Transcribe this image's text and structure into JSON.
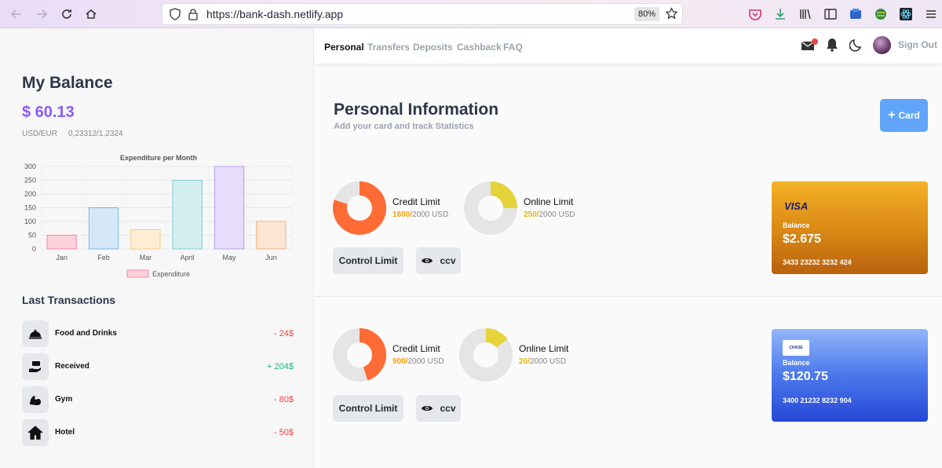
{
  "browser": {
    "url": "https://bank-dash.netlify.app",
    "zoom": "80%"
  },
  "sidebar": {
    "balance_title": "My Balance",
    "balance_amount": "$ 60.13",
    "rate_label": "USD/EUR",
    "rate_value": "0,23312/1,2324",
    "transactions_title": "Last Transactions",
    "transactions": [
      {
        "name": "Food and Drinks",
        "amount": "- 24$",
        "type": "negative",
        "icon": "food-cloche-icon"
      },
      {
        "name": "Received",
        "amount": "+ 204$",
        "type": "positive",
        "icon": "money-hand-icon"
      },
      {
        "name": "Gym",
        "amount": "- 80$",
        "type": "negative",
        "icon": "muscle-arm-icon"
      },
      {
        "name": "Hotel",
        "amount": "- 50$",
        "type": "negative",
        "icon": "house-icon"
      }
    ]
  },
  "chart_data": {
    "type": "bar",
    "title": "Expenditure per Month",
    "categories": [
      "Jan",
      "Feb",
      "Mar",
      "April",
      "May",
      "Jun"
    ],
    "series": [
      {
        "name": "Expenditure",
        "values": [
          50,
          150,
          70,
          250,
          300,
          100
        ]
      }
    ],
    "bar_colors": [
      "#fbd1dc",
      "#d4e8f8",
      "#fdedd3",
      "#d3efef",
      "#e6dcfb",
      "#fde6d3"
    ],
    "bar_borders": [
      "#f58aa5",
      "#7fb6e8",
      "#f6cc86",
      "#7fcfcf",
      "#b69cf1",
      "#f5b07f"
    ],
    "ylim": [
      0,
      300
    ],
    "yticks": [
      "300",
      "250",
      "200",
      "150",
      "100",
      "50",
      "0"
    ],
    "legend": "bottom",
    "grid": true
  },
  "topnav": {
    "tabs": [
      "Personal",
      "Transfers",
      "Deposits",
      "Cashback",
      "FAQ"
    ],
    "signout": "Sign Out"
  },
  "main": {
    "title": "Personal Information",
    "subtitle": "Add your card and track Statistics",
    "add_card_label": "Card",
    "control_limit_label": "Control Limit",
    "ccv_label": "ccv",
    "cards": [
      {
        "credit_title": "Credit Limit",
        "credit_used": "1600/",
        "credit_total": "2000 USD",
        "credit_fraction": 0.8,
        "online_title": "Online Limit",
        "online_used": "250/",
        "online_total": "2000 USD",
        "online_fraction": 0.25,
        "brand": "VISA",
        "balance_label": "Balance",
        "balance": "$2.675",
        "number": "3433 23232 3232 424"
      },
      {
        "credit_title": "Credit Limit",
        "credit_used": "900/",
        "credit_total": "2000 USD",
        "credit_fraction": 0.45,
        "online_title": "Online Limit",
        "online_used": "20/",
        "online_total": "2000 USD",
        "online_fraction": 0.15,
        "brand": "CHASE",
        "balance_label": "Balance",
        "balance": "$120.75",
        "number": "3400 21232 8232 904"
      }
    ]
  },
  "colors": {
    "accent_purple": "#8b5cf6",
    "credit_orange": "#ff6b35",
    "online_yellow": "#e5d33a",
    "button_blue": "#60a5fa"
  }
}
